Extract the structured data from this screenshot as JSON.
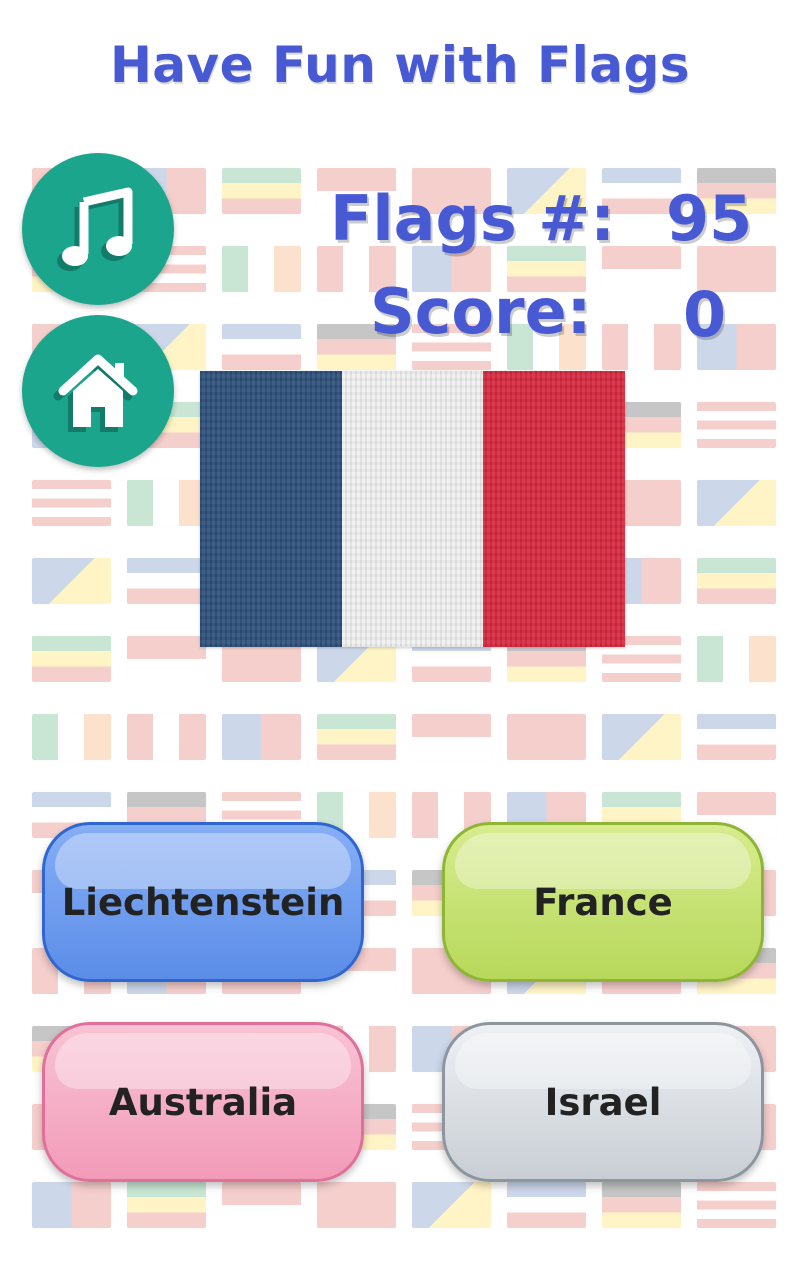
{
  "title": "Have Fun with Flags",
  "icons": {
    "music": "music-note-icon",
    "home": "home-icon"
  },
  "stats": {
    "flags_label": "Flags #:",
    "flags_value": "95",
    "score_label": "Score:",
    "score_value": "0"
  },
  "flag": {
    "stripes": [
      "#2d4f7a",
      "#f0f0f0",
      "#d7283d"
    ]
  },
  "answers": [
    "Liechtenstein",
    "France",
    "Australia",
    "Israel"
  ],
  "colors": {
    "accent": "#4859d4",
    "round_button": "#1aa58c",
    "answer_blue": "#5b8de8",
    "answer_green": "#b7d85b",
    "answer_pink": "#f29bb8",
    "answer_gray": "#c8ced4"
  }
}
